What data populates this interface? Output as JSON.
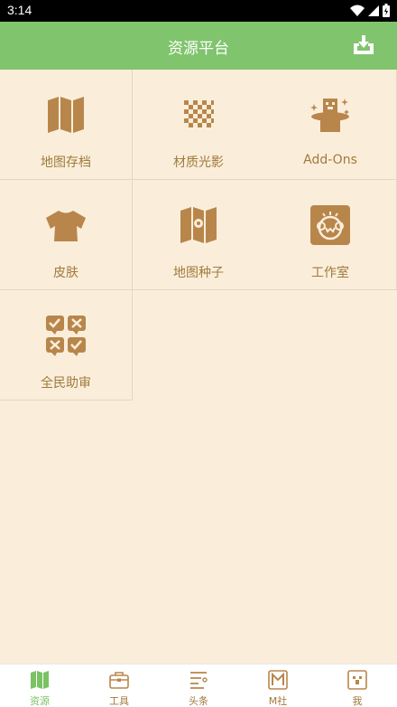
{
  "status": {
    "time": "3:14"
  },
  "header": {
    "title": "资源平台",
    "download_icon": "download-tray-icon"
  },
  "colors": {
    "accent": "#80c46d",
    "icon_brown": "#b8864b",
    "background": "#faeedb",
    "tab_active": "#7ac264"
  },
  "grid": {
    "items": [
      {
        "label": "地图存档",
        "icon": "map-icon"
      },
      {
        "label": "材质光影",
        "icon": "checker-texture-icon"
      },
      {
        "label": "Add-Ons",
        "icon": "magic-hat-icon"
      },
      {
        "label": "皮肤",
        "icon": "shirt-icon"
      },
      {
        "label": "地图种子",
        "icon": "map-seed-icon"
      },
      {
        "label": "工作室",
        "icon": "studio-icon"
      },
      {
        "label": "全民助审",
        "icon": "review-icon"
      }
    ]
  },
  "tabbar": {
    "tabs": [
      {
        "label": "资源",
        "icon": "map-tab-icon",
        "active": true
      },
      {
        "label": "工具",
        "icon": "toolbox-icon",
        "active": false
      },
      {
        "label": "头条",
        "icon": "news-icon",
        "active": false
      },
      {
        "label": "M社",
        "icon": "m-community-icon",
        "active": false
      },
      {
        "label": "我",
        "icon": "profile-icon",
        "active": false
      }
    ]
  }
}
